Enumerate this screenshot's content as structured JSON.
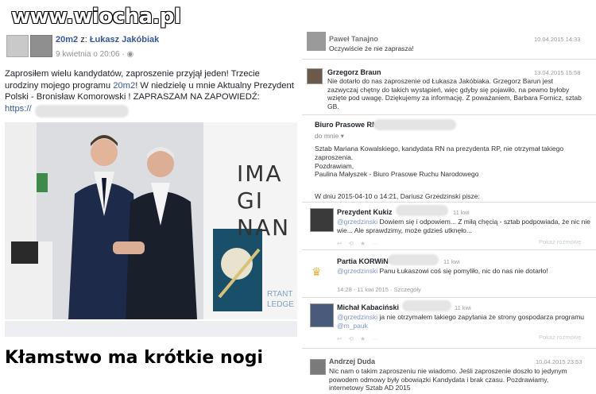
{
  "watermark": "www.wiocha.pl",
  "post": {
    "author_prefix": "20m2",
    "author_sep": " z: ",
    "author": "Łukasz Jakóbiak",
    "time": "9 kwietnia o 20:06 · ",
    "text1": "Zaprosiłem wielu kandydatów, zaproszenie przyjął jeden! Trzecie urodziny mojego programu ",
    "text_hl": "20m2",
    "text2": "! W niedzielę u mnie Aktualny Prezydent Polski - Bronisław Komorowski ! ZAPRASZAM NA ZAPOWIEDŹ:",
    "url": "https://",
    "photo_sign": "IMA GI NAN",
    "photo_sign2": "RTANT LEDGE"
  },
  "caption": "Kłamstwo ma krótkie nogi",
  "right": {
    "m1": {
      "name": "Paweł Tanajno",
      "date": "10.04.2015 14:33",
      "text": "Oczywiście że nie zaprasza!"
    },
    "m2": {
      "name": "Grzegorz Braun",
      "date": "13.04.2015 15:58",
      "text": "Nie dotarło do nas zaproszenie od Łukasza Jakóbiaka. Grzegorz Barun jest zazwyczaj chętny do takich wystąpień, więc gdyby się pojawiło, na pewno byłoby wzięte pod uwagę. Dziękujemy za informację. Z poważaniem, Barbara Fornicz, sztab GB."
    },
    "m3": {
      "name": "Biuro Prasowe RN",
      "to": "do mnie",
      "line1": "Sztab Mariana Kowalskiego, kandydata RN na prezydenta RP, nie otrzymał takiego zaproszenia.",
      "line2": "Pozdrawiam,",
      "line3": "Paulina Małyszek - Biuro Prasowe Ruchu Narodowego",
      "quote": "W dniu 2015-04-10 o 14:21, Dariusz Grzedzinski pisze:"
    },
    "m4": {
      "name": "Prezydent Kukiz",
      "date": "11 kwi",
      "mention": "@grzedzinski",
      "text": " Dowiem się i odpowiem... Z miłą chęcią - sztab podpowiada, że nic nie wie... Ale sprawdzimy, może gdzieś utknęło...",
      "reply": "Pokaż rozmowę"
    },
    "m5": {
      "name": "Partia KORWiN",
      "date": "11 kwi",
      "mention": "@grzedzinski",
      "text": " Panu Łukaszowi coś się pomyliło, nic do nas nie dotarło!",
      "meta": "14:28 - 11 kwi 2015 · Szczegóły"
    },
    "m6": {
      "name": "Michał Kabaciński",
      "date": "11 kwi",
      "mention": "@grzedzinski",
      "text": " ja nie otrzymałem takiego zapytania że strony gospodarza programu ",
      "mention2": "@m_pauk",
      "reply": "Pokaż rozmowę"
    },
    "m7": {
      "name": "Andrzej Duda",
      "date": "10.04.2015 23:53",
      "text": "Nic nam o takim zaproszeniu nie wiadomo. Jeśli zaproszenie doszło to jedynym powodem odmowy były obowiązki Kandydata i brak czasu. Pozdrawiamy, internetowy Sztab AD 2015"
    }
  }
}
